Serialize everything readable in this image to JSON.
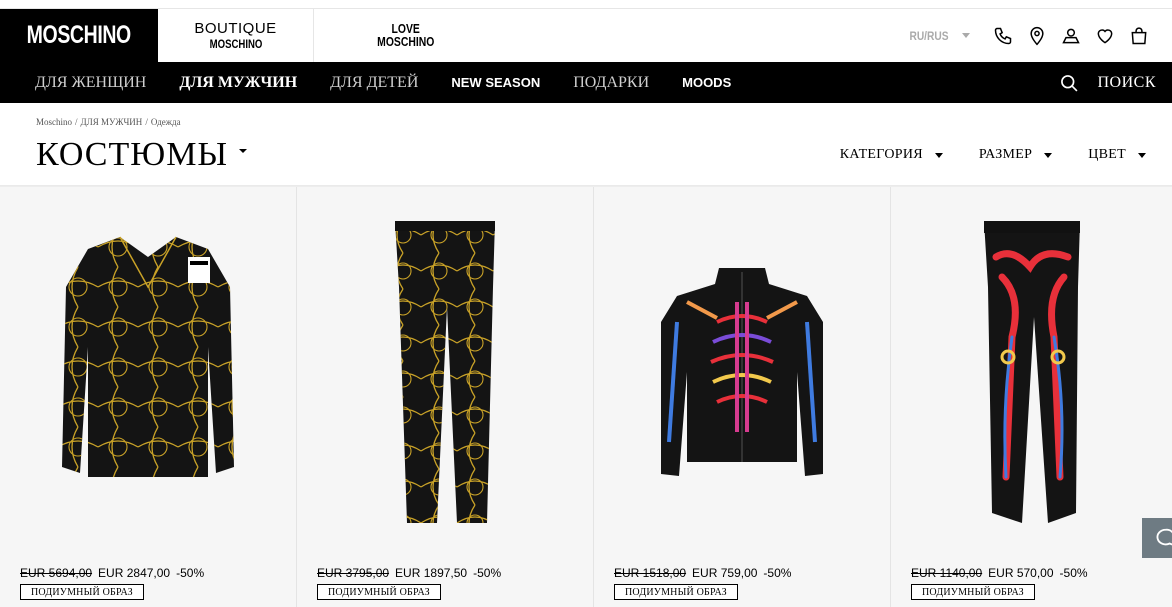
{
  "brands": {
    "moschino": "MOSCHINO",
    "boutique_line1": "BOUTIQUE",
    "boutique_line2": "MOSCHINO",
    "love_line1": "LOVE",
    "love_line2": "MOSCHINO"
  },
  "utilities": {
    "locale": "RU/RUS",
    "icons": [
      "phone-icon",
      "location-pin-icon",
      "user-icon",
      "heart-icon",
      "shopping-bag-icon"
    ]
  },
  "nav": {
    "items": [
      {
        "label": "ДЛЯ ЖЕНЩИН",
        "active": false
      },
      {
        "label": "ДЛЯ МУЖЧИН",
        "active": true
      },
      {
        "label": "ДЛЯ ДЕТЕЙ",
        "active": false
      },
      {
        "label": "NEW SEASON",
        "active": false
      },
      {
        "label": "ПОДАРКИ",
        "active": false
      },
      {
        "label": "MOODS",
        "active": false
      }
    ],
    "search_label": "ПОИСК"
  },
  "breadcrumb": [
    "Moschino",
    "/",
    "ДЛЯ МУЖЧИН",
    "/",
    "Одежда"
  ],
  "page": {
    "title": "КОСТЮМЫ"
  },
  "filters": [
    {
      "label": "КАТЕГОРИЯ"
    },
    {
      "label": "РАЗМЕР"
    },
    {
      "label": "ЦВЕТ"
    }
  ],
  "products": [
    {
      "old_price": "EUR 5694,00",
      "price": "EUR 2847,00",
      "discount": "-50%",
      "tag": "ПОДИУМНЫЙ ОБРАЗ",
      "image": "spiderweb-jacket"
    },
    {
      "old_price": "EUR 3795,00",
      "price": "EUR 1897,50",
      "discount": "-50%",
      "tag": "ПОДИУМНЫЙ ОБРАЗ",
      "image": "spiderweb-trousers"
    },
    {
      "old_price": "EUR 1518,00",
      "price": "EUR 759,00",
      "discount": "-50%",
      "tag": "ПОДИУМНЫЙ ОБРАЗ",
      "image": "skeleton-zip-jacket"
    },
    {
      "old_price": "EUR 1140,00",
      "price": "EUR 570,00",
      "discount": "-50%",
      "tag": "ПОДИУМНЫЙ ОБРАЗ",
      "image": "skeleton-joggers"
    }
  ],
  "colors": {
    "black": "#000000",
    "nav_inactive": "#cfcfcf",
    "card_bg": "#f6f6f6",
    "gold": "#c9a227",
    "locale_grey": "#aaaaaa"
  }
}
